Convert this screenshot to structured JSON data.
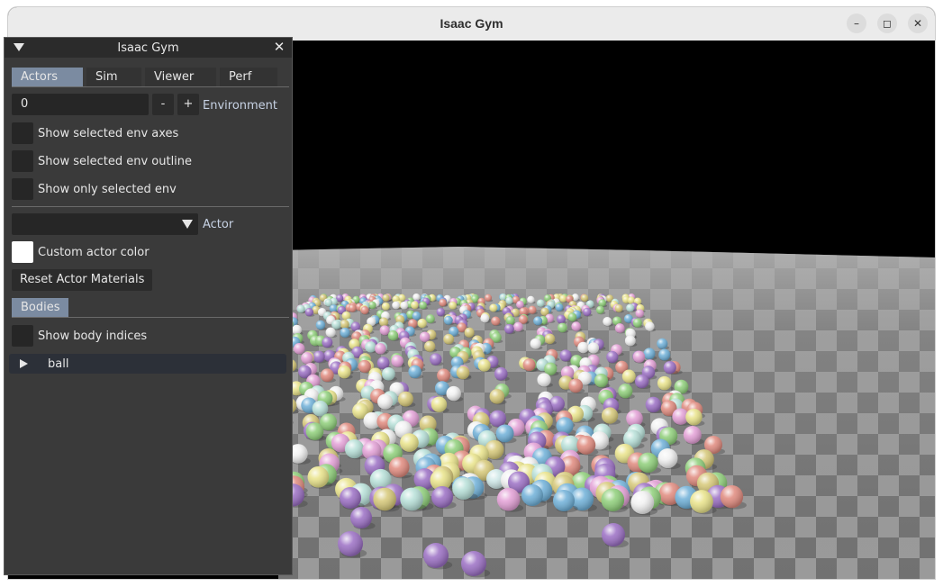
{
  "window": {
    "title": "Isaac Gym"
  },
  "window_controls": {
    "minimize": "–",
    "maximize": "◻",
    "close": "✕"
  },
  "panel": {
    "title": "Isaac Gym",
    "close_glyph": "✕",
    "tabs": [
      {
        "label": "Actors",
        "active": true
      },
      {
        "label": "Sim",
        "active": false
      },
      {
        "label": "Viewer",
        "active": false
      },
      {
        "label": "Perf",
        "active": false
      }
    ],
    "environment": {
      "value": "0",
      "minus": "-",
      "plus": "+",
      "label": "Environment"
    },
    "checks": [
      {
        "label": "Show selected env axes",
        "checked": false
      },
      {
        "label": "Show selected env outline",
        "checked": false
      },
      {
        "label": "Show only selected env",
        "checked": false
      }
    ],
    "actor": {
      "value": "",
      "label": "Actor"
    },
    "custom_color": {
      "label": "Custom actor color",
      "color": "#ffffff"
    },
    "reset_button": "Reset Actor Materials",
    "bodies_tab": "Bodies",
    "show_body_indices": "Show body indices",
    "tree_item": "ball"
  },
  "colors": {
    "panel_bg": "#3a3a3a",
    "tab_active": "#7b8ba1",
    "label_accent": "#c7d2e4",
    "floor_light": "#9a9a9a",
    "floor_dark": "#707070"
  }
}
